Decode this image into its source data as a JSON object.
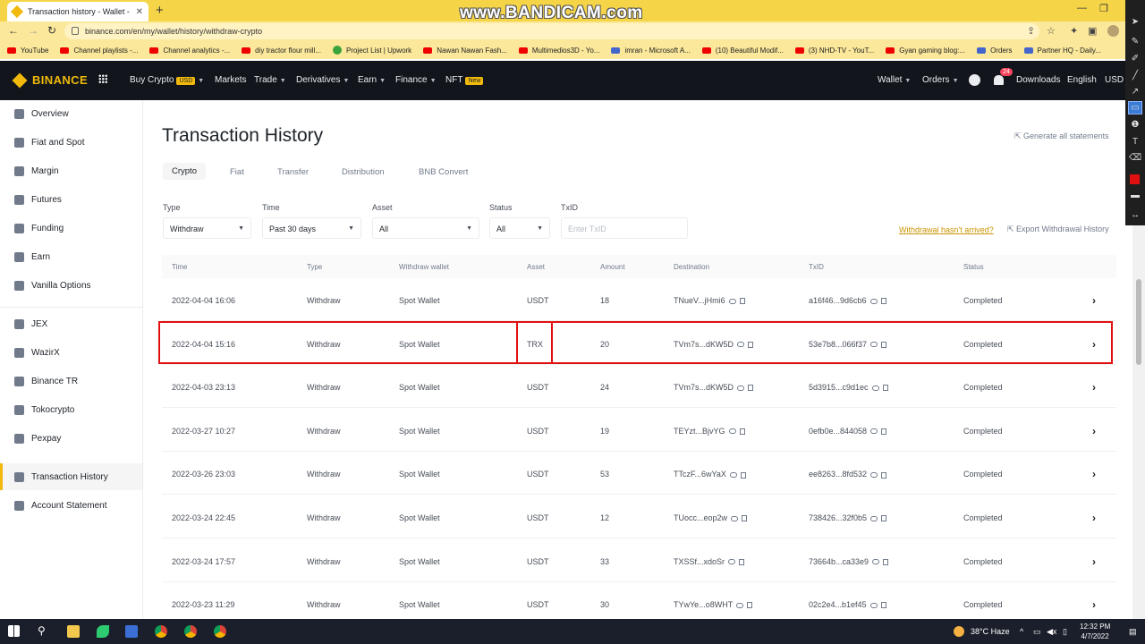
{
  "browser": {
    "tab_title": "Transaction history - Wallet - Bin",
    "new_tab": "+",
    "url": "binance.com/en/my/wallet/history/withdraw-crypto",
    "watermark": "www.BANDICAM.com",
    "bookmarks": [
      {
        "label": "YouTube",
        "icon": "red"
      },
      {
        "label": "Channel playlists -...",
        "icon": "red"
      },
      {
        "label": "Channel analytics -...",
        "icon": "red"
      },
      {
        "label": "diy tractor flour mill...",
        "icon": "red"
      },
      {
        "label": "Project List | Upwork",
        "icon": "green"
      },
      {
        "label": "Nawan Nawan Fash...",
        "icon": "red"
      },
      {
        "label": "Multimedios3D - Yo...",
        "icon": "red"
      },
      {
        "label": "imran - Microsoft A...",
        "icon": "blue"
      },
      {
        "label": "(10) Beautiful Modif...",
        "icon": "red"
      },
      {
        "label": "(3) NHD-TV - YouT...",
        "icon": "red"
      },
      {
        "label": "Gyan gaming blog:...",
        "icon": "red"
      },
      {
        "label": "Orders",
        "icon": "blue"
      },
      {
        "label": "Partner HQ - Daily...",
        "icon": "blue"
      }
    ]
  },
  "nav": {
    "logo": "BINANCE",
    "buy_crypto": "Buy Crypto",
    "usd_badge": "USD",
    "markets": "Markets",
    "trade": "Trade",
    "derivatives": "Derivatives",
    "earn": "Earn",
    "finance": "Finance",
    "nft": "NFT",
    "new_badge": "New",
    "wallet": "Wallet",
    "orders": "Orders",
    "notif_count": "24",
    "downloads": "Downloads",
    "language": "English",
    "currency": "USD"
  },
  "sidebar": {
    "items": [
      "Overview",
      "Fiat and Spot",
      "Margin",
      "Futures",
      "Funding",
      "Earn",
      "Vanilla Options",
      "JEX",
      "WazirX",
      "Binance TR",
      "Tokocrypto",
      "Pexpay",
      "Transaction History",
      "Account Statement"
    ],
    "active": "Transaction History"
  },
  "page": {
    "title": "Transaction History",
    "generate_statements": "Generate all statements",
    "tabs": [
      "Crypto",
      "Fiat",
      "Transfer",
      "Distribution",
      "BNB Convert"
    ],
    "active_tab": "Crypto"
  },
  "filters": {
    "type_label": "Type",
    "type_value": "Withdraw",
    "time_label": "Time",
    "time_value": "Past 30 days",
    "asset_label": "Asset",
    "asset_value": "All",
    "status_label": "Status",
    "status_value": "All",
    "txid_label": "TxID",
    "txid_placeholder": "Enter TxID",
    "withdrawal_link": "Withdrawal hasn't arrived?",
    "export_label": "Export Withdrawal History"
  },
  "table": {
    "columns": [
      "Time",
      "Type",
      "Withdraw wallet",
      "Asset",
      "Amount",
      "Destination",
      "TxID",
      "Status"
    ],
    "rows": [
      {
        "time": "2022-04-04 16:06",
        "type": "Withdraw",
        "wallet": "Spot Wallet",
        "asset": "USDT",
        "amount": "18",
        "destination": "TNueV...jHmi6",
        "txid": "a16f46...9d6cb6",
        "status": "Completed"
      },
      {
        "time": "2022-04-04 15:16",
        "type": "Withdraw",
        "wallet": "Spot Wallet",
        "asset": "TRX",
        "amount": "20",
        "destination": "TVm7s...dKW5D",
        "txid": "53e7b8...066f37",
        "status": "Completed"
      },
      {
        "time": "2022-04-03 23:13",
        "type": "Withdraw",
        "wallet": "Spot Wallet",
        "asset": "USDT",
        "amount": "24",
        "destination": "TVm7s...dKW5D",
        "txid": "5d3915...c9d1ec",
        "status": "Completed"
      },
      {
        "time": "2022-03-27 10:27",
        "type": "Withdraw",
        "wallet": "Spot Wallet",
        "asset": "USDT",
        "amount": "19",
        "destination": "TEYzt...BjvYG",
        "txid": "0efb0e...844058",
        "status": "Completed"
      },
      {
        "time": "2022-03-26 23:03",
        "type": "Withdraw",
        "wallet": "Spot Wallet",
        "asset": "USDT",
        "amount": "53",
        "destination": "TTczF...6wYaX",
        "txid": "ee8263...8fd532",
        "status": "Completed"
      },
      {
        "time": "2022-03-24 22:45",
        "type": "Withdraw",
        "wallet": "Spot Wallet",
        "asset": "USDT",
        "amount": "12",
        "destination": "TUocc...eop2w",
        "txid": "738426...32f0b5",
        "status": "Completed"
      },
      {
        "time": "2022-03-24 17:57",
        "type": "Withdraw",
        "wallet": "Spot Wallet",
        "asset": "USDT",
        "amount": "33",
        "destination": "TXSSf...xdoSr",
        "txid": "73664b...ca33e9",
        "status": "Completed"
      },
      {
        "time": "2022-03-23 11:29",
        "type": "Withdraw",
        "wallet": "Spot Wallet",
        "asset": "USDT",
        "amount": "30",
        "destination": "TYwYe...o8WHT",
        "txid": "02c2e4...b1ef45",
        "status": "Completed"
      }
    ]
  },
  "taskbar": {
    "weather": "38°C Haze",
    "time": "12:32 PM",
    "date": "4/7/2022"
  }
}
